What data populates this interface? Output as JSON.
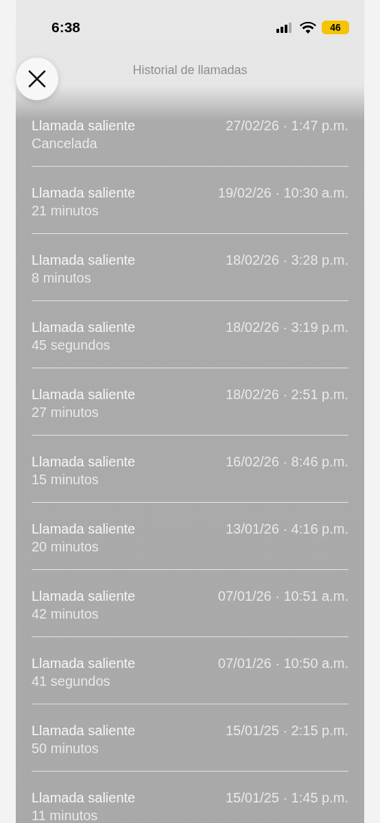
{
  "status_bar": {
    "time": "6:38",
    "battery": "46"
  },
  "header": {
    "title": "Historial de llamadas"
  },
  "calls": [
    {
      "type": "Llamada saliente",
      "detail": "Cancelada",
      "date": "27/02/26 · 1:47",
      "period": "p.m."
    },
    {
      "type": "Llamada saliente",
      "detail": "21 minutos",
      "date": "19/02/26 · 10:30",
      "period": "a.m."
    },
    {
      "type": "Llamada saliente",
      "detail": "8 minutos",
      "date": "18/02/26 · 3:28",
      "period": "p.m."
    },
    {
      "type": "Llamada saliente",
      "detail": "45 segundos",
      "date": "18/02/26 · 3:19",
      "period": "p.m."
    },
    {
      "type": "Llamada saliente",
      "detail": "27 minutos",
      "date": "18/02/26 · 2:51",
      "period": "p.m."
    },
    {
      "type": "Llamada saliente",
      "detail": "15 minutos",
      "date": "16/02/26 · 8:46",
      "period": "p.m."
    },
    {
      "type": "Llamada saliente",
      "detail": "20 minutos",
      "date": "13/01/26 · 4:16",
      "period": "p.m."
    },
    {
      "type": "Llamada saliente",
      "detail": "42 minutos",
      "date": "07/01/26 · 10:51",
      "period": "a.m."
    },
    {
      "type": "Llamada saliente",
      "detail": "41 segundos",
      "date": "07/01/26 · 10:50",
      "period": "a.m."
    },
    {
      "type": "Llamada saliente",
      "detail": "50 minutos",
      "date": "15/01/25 · 2:15",
      "period": "p.m."
    },
    {
      "type": "Llamada saliente",
      "detail": "11 minutos",
      "date": "15/01/25 · 1:45",
      "period": "p.m."
    }
  ]
}
